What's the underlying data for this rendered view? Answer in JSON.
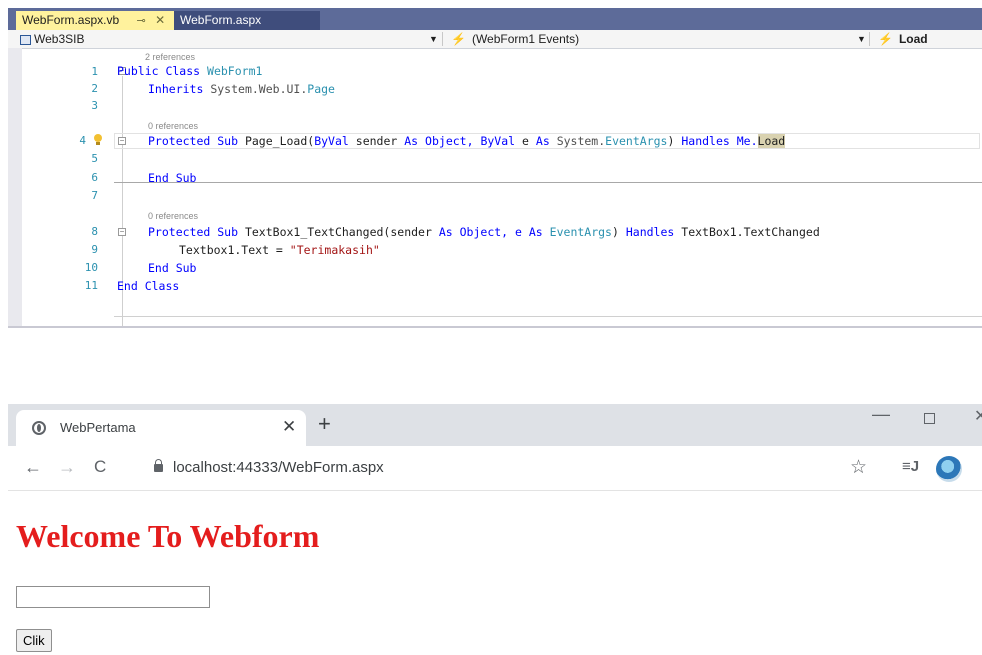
{
  "editor": {
    "tabs": [
      {
        "label": "WebForm.aspx.vb",
        "active": true
      },
      {
        "label": "WebForm.aspx",
        "active": false
      }
    ],
    "nav": {
      "project": "Web3SIB",
      "events": "(WebForm1 Events)",
      "method": "Load"
    },
    "refs": {
      "class_refs": "2 references",
      "load_refs": "0 references",
      "textchanged_refs": "0 references"
    },
    "line_numbers": [
      "1",
      "2",
      "3",
      "4",
      "5",
      "6",
      "7",
      "8",
      "9",
      "10",
      "11"
    ],
    "code": {
      "l1_kw": "Public Class",
      "l1_name": "WebForm1",
      "l2_kw": "Inherits",
      "l2_ns": "System.Web.UI.",
      "l2_type": "Page",
      "l4_kw": "Protected Sub",
      "l4_name": "Page_Load(",
      "l4_byval1": "ByVal",
      "l4_sender": "sender",
      "l4_as1": "As",
      "l4_obj": "Object,",
      "l4_byval2": "ByVal",
      "l4_e": "e",
      "l4_as2": "As",
      "l4_sys": "System.",
      "l4_type": "EventArgs",
      "l4_close": ")",
      "l4_handles": "Handles",
      "l4_me": "Me.",
      "l4_load": "Load",
      "l6_endsub": "End Sub",
      "l8_kw": "Protected Sub",
      "l8_name": "TextBox1_TextChanged(sender",
      "l8_as1": "As",
      "l8_obj": "Object, e",
      "l8_as2": "As",
      "l8_type": "EventArgs",
      "l8_close": ")",
      "l8_handles": "Handles",
      "l8_target": "TextBox1.TextChanged",
      "l9_stmt": "Textbox1.Text = ",
      "l9_str": "\"Terimakasih\"",
      "l10_endsub": "End Sub",
      "l11_endclass": "End Class"
    }
  },
  "browser": {
    "tab_title": "WebPertama",
    "close_glyph": "✕",
    "newtab_glyph": "+",
    "url": "localhost:44333/WebForm.aspx",
    "window_controls": {
      "min": "—",
      "close": "✕"
    },
    "nav_glyphs": {
      "back": "←",
      "forward": "→",
      "reload": "C"
    },
    "star_glyph": "☆",
    "readlist_glyph": "≡J",
    "page": {
      "heading": "Welcome To Webform",
      "input_value": "",
      "button_label": "Clik"
    }
  },
  "colors": {
    "vs_tab_bar": "#5d6b99",
    "vs_active_tab": "#fff29d",
    "heading_red": "#e41d1d",
    "keyword_blue": "#0000ff",
    "type_teal": "#2b91af",
    "string_red": "#a31515"
  }
}
